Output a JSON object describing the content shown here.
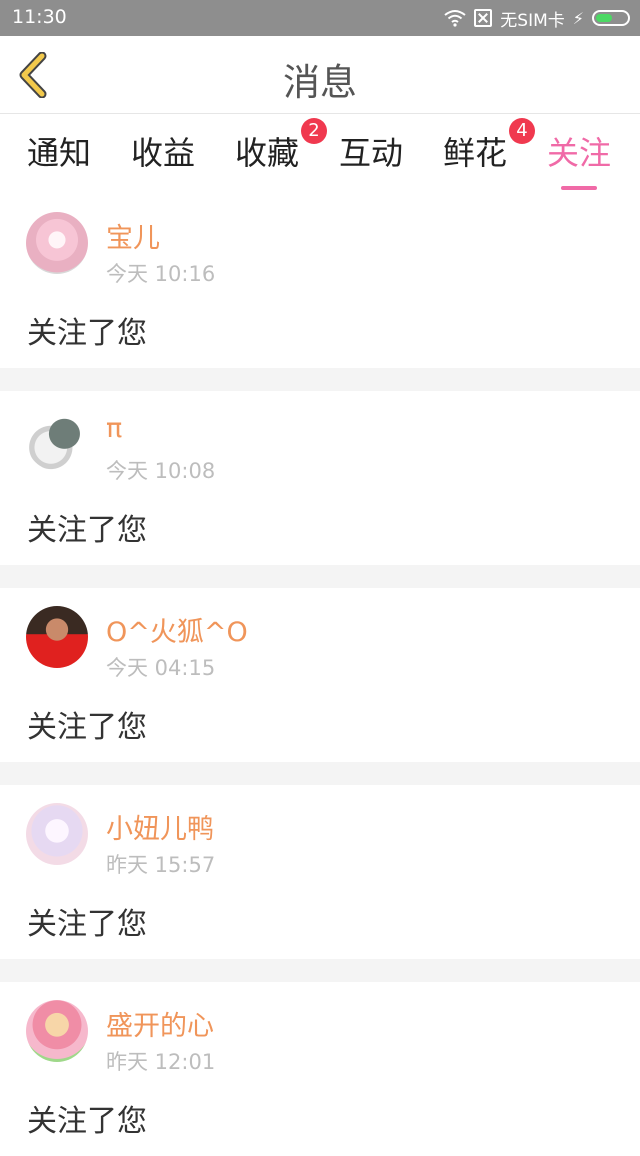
{
  "status_bar": {
    "time": "11:30",
    "sim_text": "无SIM卡"
  },
  "header": {
    "title": "消息"
  },
  "tabs": [
    {
      "label": "通知"
    },
    {
      "label": "收益"
    },
    {
      "label": "收藏",
      "badge": "2"
    },
    {
      "label": "互动"
    },
    {
      "label": "鲜花",
      "badge": "4"
    },
    {
      "label": "关注",
      "active": true
    }
  ],
  "messages": [
    {
      "name": "宝儿",
      "time": "今天 10:16",
      "text": "关注了您"
    },
    {
      "name": "π",
      "time": "今天 10:08",
      "text": "关注了您"
    },
    {
      "name": "O^火狐^O",
      "time": "今天 04:15",
      "text": "关注了您"
    },
    {
      "name": "小妞儿鸭",
      "time": "昨天 15:57",
      "text": "关注了您"
    },
    {
      "name": "盛开的心",
      "time": "昨天 12:01",
      "text": "关注了您"
    }
  ],
  "colors": {
    "accent": "#f06aa7",
    "name": "#f0955a",
    "badge": "#f0394f",
    "back_icon": "#f2c94c"
  }
}
